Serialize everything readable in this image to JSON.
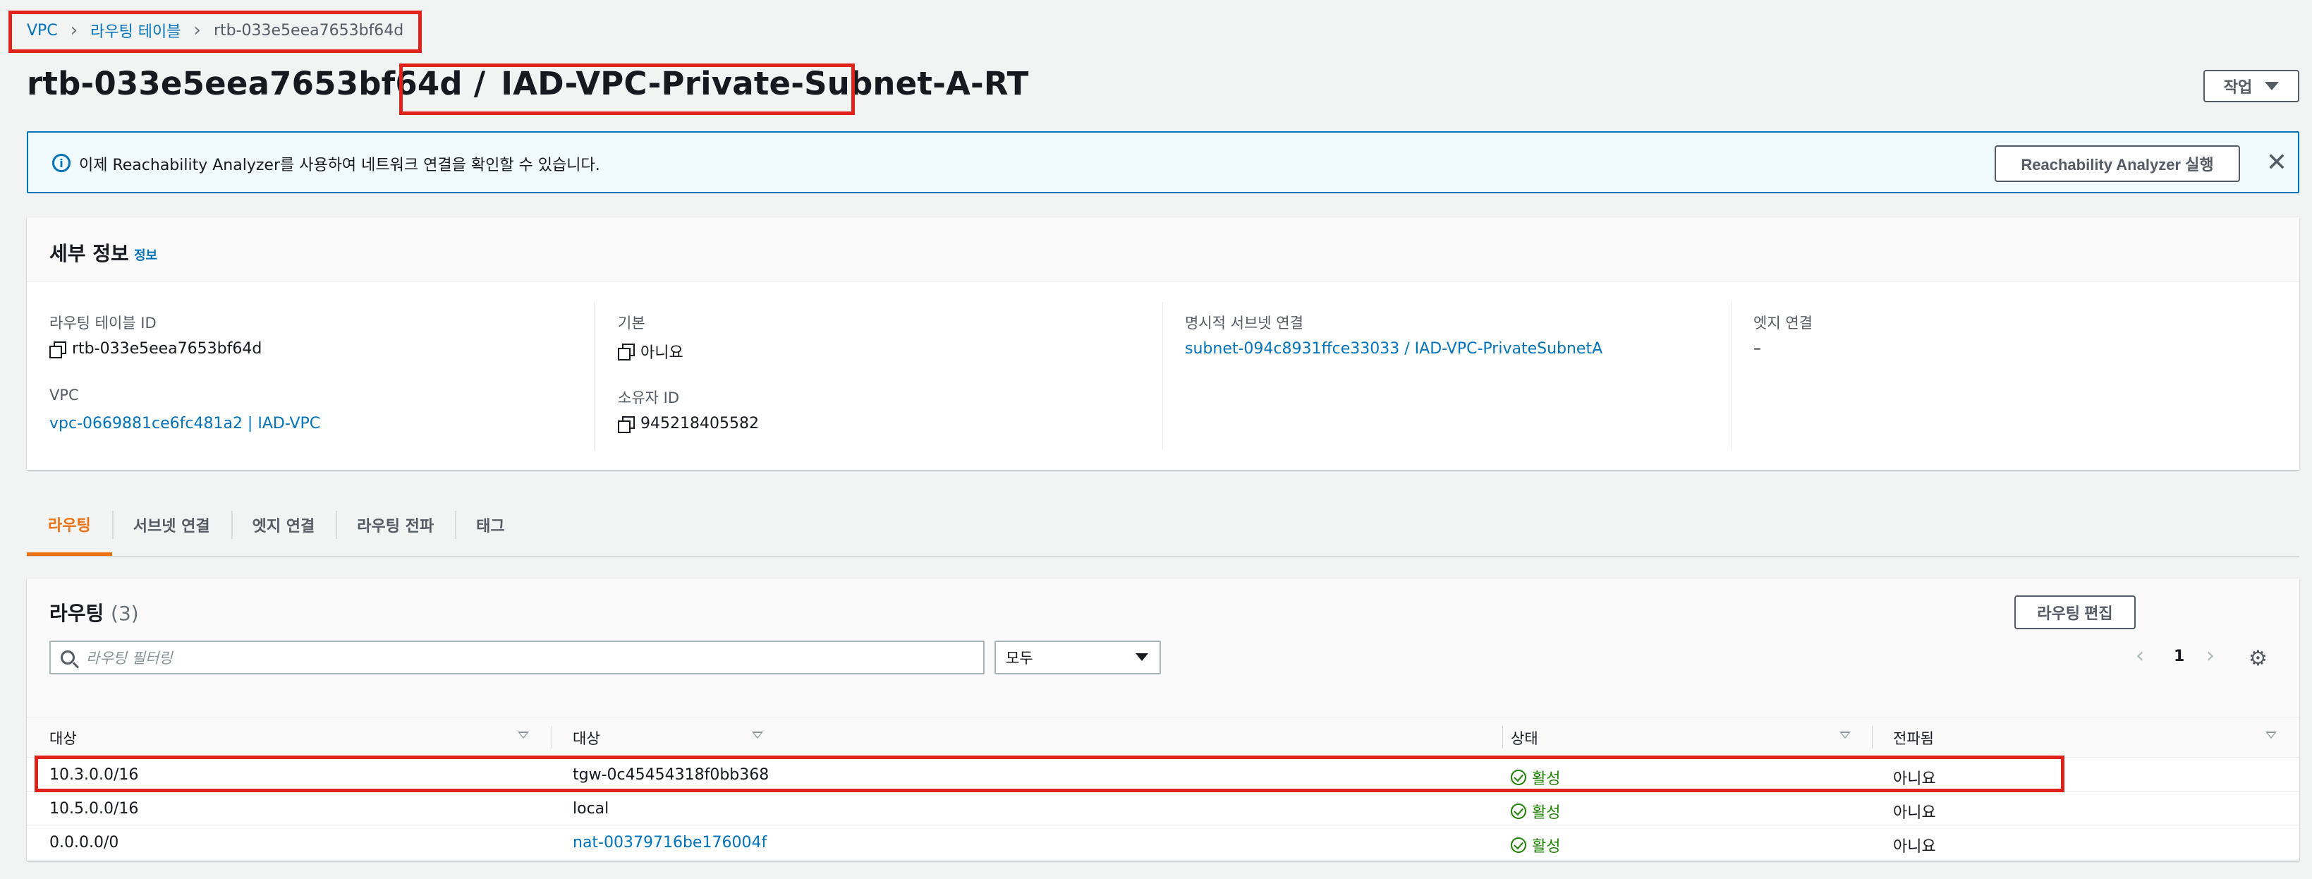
{
  "breadcrumb": {
    "vpc": "VPC",
    "route_tables": "라우팅 테이블",
    "current": "rtb-033e5eea7653bf64d"
  },
  "header": {
    "route_table_id": "rtb-033e5eea7653bf64d",
    "separator": "/",
    "name": "IAD-VPC-Private-Subnet-A-RT",
    "actions_label": "작업"
  },
  "banner": {
    "text": "이제 Reachability Analyzer를 사용하여 네트워크 연결을 확인할 수 있습니다.",
    "button_label": "Reachability Analyzer 실행"
  },
  "details": {
    "title": "세부 정보",
    "info_link": "정보",
    "fields": {
      "rt_id_label": "라우팅 테이블 ID",
      "rt_id_value": "rtb-033e5eea7653bf64d",
      "vpc_label": "VPC",
      "vpc_value": "vpc-0669881ce6fc481a2 | IAD-VPC",
      "main_label": "기본",
      "main_value": "아니요",
      "owner_label": "소유자 ID",
      "owner_value": "945218405582",
      "explicit_label": "명시적 서브넷 연결",
      "explicit_value": "subnet-094c8931ffce33033 / IAD-VPC-PrivateSubnetA",
      "edge_label": "엣지 연결",
      "edge_value": "–"
    }
  },
  "tabs": [
    "라우팅",
    "서브넷 연결",
    "엣지 연결",
    "라우팅 전파",
    "태그"
  ],
  "routes": {
    "title": "라우팅",
    "count": "(3)",
    "edit_label": "라우팅 편집",
    "search_placeholder": "라우팅 필터링",
    "filter_value": "모두",
    "page": "1",
    "columns": [
      "대상",
      "대상",
      "상태",
      "전파됨"
    ],
    "rows": [
      {
        "destination": "10.3.0.0/16",
        "target": "tgw-0c45454318f0bb368",
        "status": "활성",
        "propagated": "아니요"
      },
      {
        "destination": "10.5.0.0/16",
        "target": "local",
        "status": "활성",
        "propagated": "아니요"
      },
      {
        "destination": "0.0.0.0/0",
        "target": "nat-00379716be176004f",
        "status": "활성",
        "propagated": "아니요"
      }
    ]
  },
  "colors": {
    "link": "#0073bb",
    "active_tab": "#ec7211",
    "status_ok": "#1d8102",
    "highlight": "#e0231a"
  }
}
